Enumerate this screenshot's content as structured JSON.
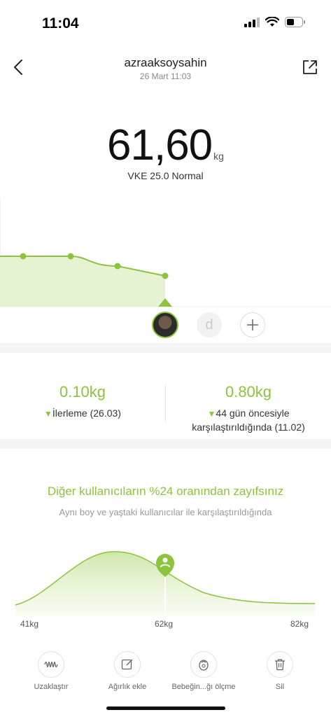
{
  "status": {
    "time": "11:04"
  },
  "header": {
    "title": "azraaksoysahin",
    "subtitle": "26 Mart 11:03"
  },
  "measurement": {
    "weight": "61,60",
    "unit": "kg",
    "bmi": "VKE 25.0 Normal"
  },
  "trend": {
    "points_kg": [
      61.9,
      61.9,
      61.75,
      61.6
    ]
  },
  "users": {
    "second_initial": "d"
  },
  "stats": {
    "left": {
      "value": "0.10kg",
      "label": "İlerleme (26.03)"
    },
    "right": {
      "value": "0.80kg",
      "label_line1": "44 gün öncesiyle",
      "label_line2": "karşılaştırıldığında (11.02)"
    }
  },
  "comparison": {
    "title": "Diğer kullanıcıların %24 oranından zayıfsınız",
    "subtitle": "Aynı boy ve yaştaki kullanıcılar ile karşılaştırıldığında",
    "min_label": "41kg",
    "mid_label": "62kg",
    "max_label": "82kg"
  },
  "actions": [
    {
      "label": "Uzaklaştır",
      "icon": "waveform-icon"
    },
    {
      "label": "Ağırlık ekle",
      "icon": "edit-icon"
    },
    {
      "label": "Bebeğin...ğı ölçme",
      "icon": "baby-icon"
    },
    {
      "label": "Sil",
      "icon": "trash-icon"
    }
  ],
  "colors": {
    "accent": "#8cc43b",
    "accent_light": "#e6f3d3"
  }
}
